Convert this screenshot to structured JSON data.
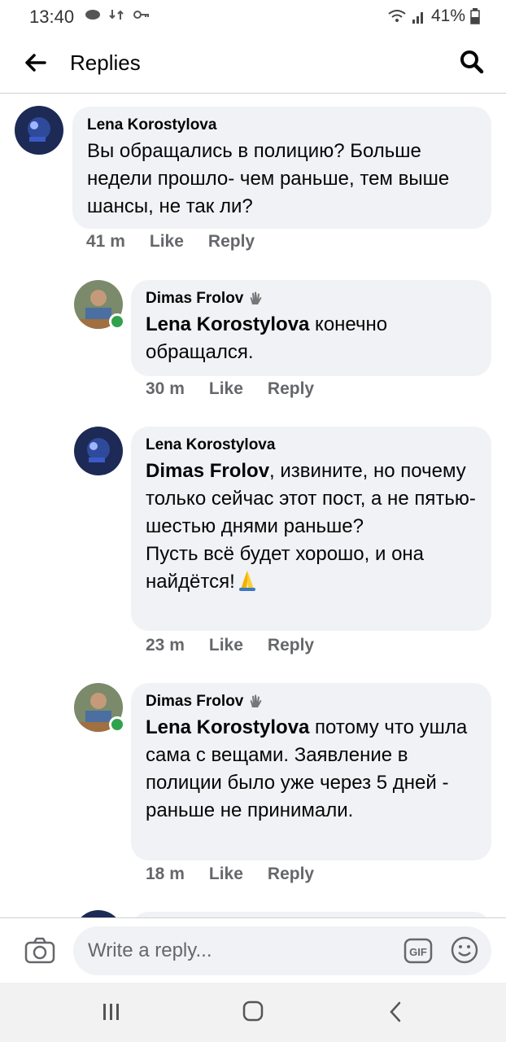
{
  "status_bar": {
    "time": "13:40",
    "battery": "41%"
  },
  "header": {
    "title": "Replies"
  },
  "comments": [
    {
      "author": "Lena  Korostylova",
      "mention": "",
      "text": "Вы обращались в полицию? Больше недели прошло- чем раньше, тем выше шансы, не так ли?",
      "time": "41 m",
      "like": "Like",
      "reply": "Reply"
    },
    {
      "author": "Dimas Frolov",
      "mention": "Lena  Korostylova",
      "text": " конечно обращался.",
      "time": "30 m",
      "like": "Like",
      "reply": "Reply"
    },
    {
      "author": "Lena  Korostylova",
      "mention": "Dimas Frolov",
      "text": ", извините, но почему только сейчас этот пост, а не пятью-шестью днями раньше?",
      "text2": "Пусть всё будет хорошо, и она найдётся!",
      "time": "23 m",
      "like": "Like",
      "reply": "Reply"
    },
    {
      "author": "Dimas Frolov",
      "mention": "Lena  Korostylova",
      "text": " потому что ушла сама с вещами. Заявление в полиции было уже через 5 дней - раньше не принимали.",
      "time": "18 m",
      "like": "Like",
      "reply": "Reply"
    }
  ],
  "composer": {
    "placeholder": "Write a reply...",
    "gif_label": "GIF"
  },
  "colors": {
    "bubble": "#f0f2f5",
    "meta": "#65676b",
    "online": "#31a24c"
  }
}
